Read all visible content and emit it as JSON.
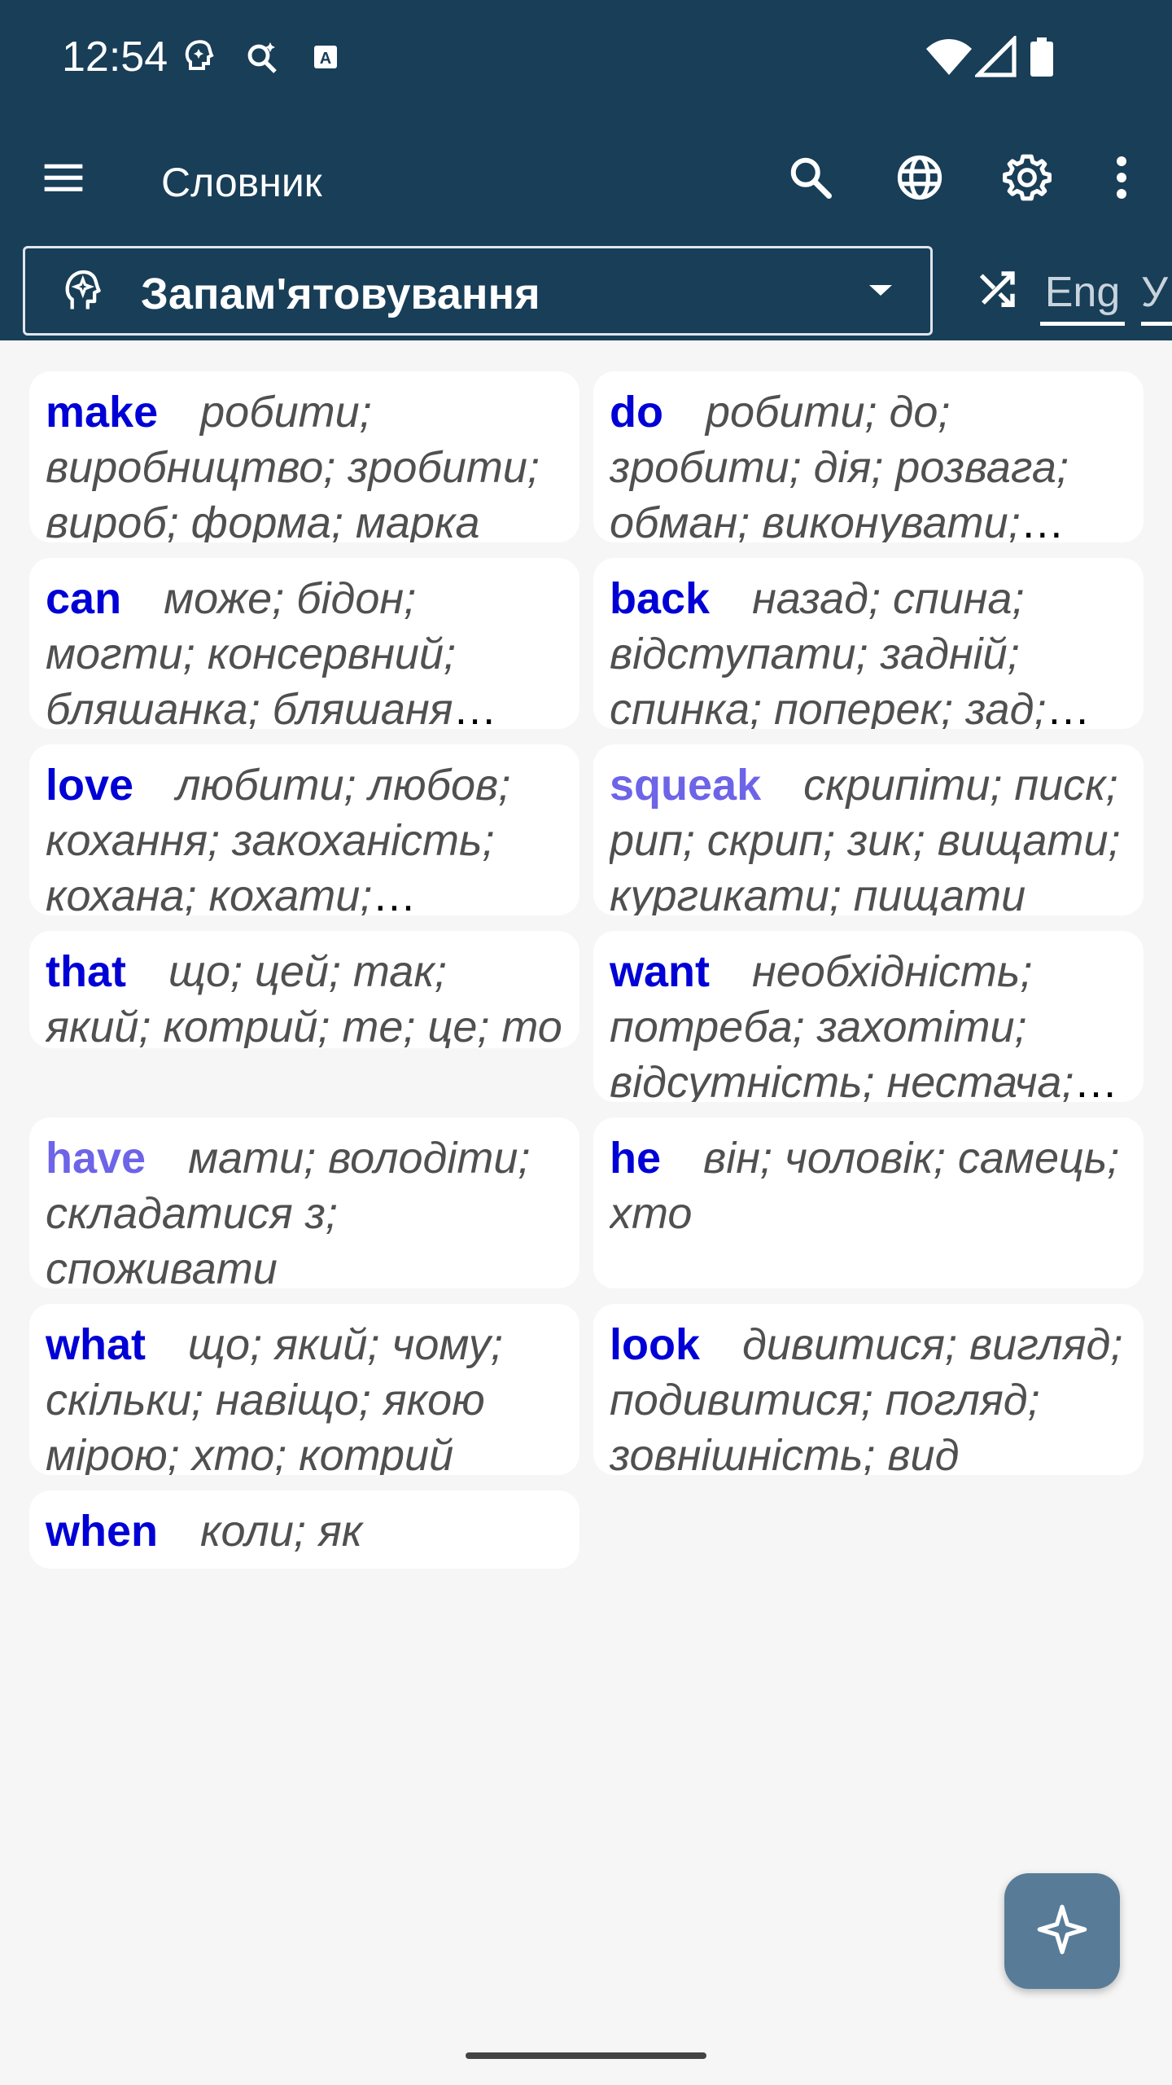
{
  "status_bar": {
    "time": "12:54",
    "icons": [
      "brain-notification-icon",
      "search-sparkle-icon",
      "translate-a-icon",
      "wifi-icon",
      "signal-icon",
      "battery-icon"
    ]
  },
  "app_bar": {
    "title": "Словник",
    "actions": [
      "menu-icon",
      "search-icon",
      "globe-icon",
      "settings-icon",
      "more-vert-icon"
    ]
  },
  "mode_selector": {
    "icon": "brain-sparkle-icon",
    "selected": "Запам'ятовування"
  },
  "language_tabs": {
    "active": "Eng",
    "next": "У"
  },
  "colors": {
    "header_bg": "#183e58",
    "word_primary": "#0000d6",
    "word_light": "#6d64e8",
    "fab_bg": "#587c97"
  },
  "words": [
    {
      "word": "make",
      "translation": "робити; виробництво; зробити; вироб; форма; марка",
      "highlight": false
    },
    {
      "word": "do",
      "translation": "робити; до; зробити; дія; розвага; обман; виконувати; вистачати",
      "highlight": false
    },
    {
      "word": "can",
      "translation": "може; бідон; могти; консервний; бляшанка; бляшаня банка",
      "highlight": false
    },
    {
      "word": "back",
      "translation": "назад; спина; відступати; задній; спинка; поперек; зад; тил",
      "highlight": false
    },
    {
      "word": "love",
      "translation": "любити; любов; кохання; закоханість; кохана; кохати; діставати",
      "highlight": false
    },
    {
      "word": "squeak",
      "translation": "скрипіти; писк; рип; скрип; зик; вищати; кургикати; пищати",
      "highlight": true
    },
    {
      "word": "that",
      "translation": "що; цей; так; який; котрий; те; це; то",
      "highlight": false
    },
    {
      "word": "want",
      "translation": "необхідність; потреба; захотіти; відсутність; нестача; хотіти",
      "highlight": false
    },
    {
      "word": "have",
      "translation": "мати; володіти; складатися з; споживати",
      "highlight": true
    },
    {
      "word": "he",
      "translation": "він; чоловік; самець; хто",
      "highlight": false
    },
    {
      "word": "what",
      "translation": "що; який; чому; скільки; навіщо; якою мірою; хто; котрий",
      "highlight": false
    },
    {
      "word": "look",
      "translation": "дивитися; вигляд; подивитися; погляд; зовнішність; вид",
      "highlight": false
    },
    {
      "word": "when",
      "translation": "коли; як",
      "highlight": false
    }
  ],
  "fab": {
    "icon": "sparkle-icon"
  }
}
